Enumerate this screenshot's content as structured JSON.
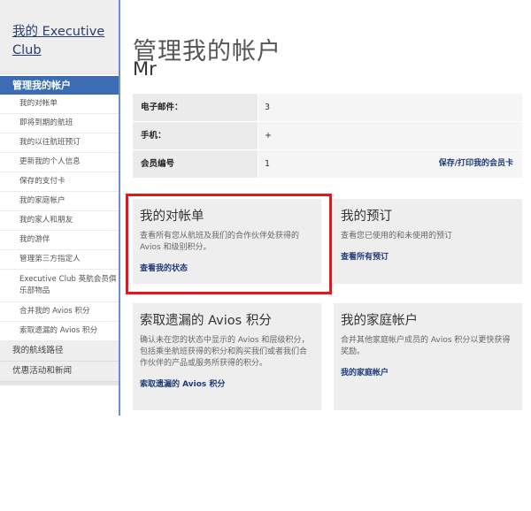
{
  "sidebar": {
    "title": "我的 Executive Club",
    "active": "管理我的帐户",
    "items": [
      "我的对帐单",
      "即将到期的航班",
      "我的以往航班预订",
      "更新我的个人信息",
      "保存的支付卡",
      "我的家庭帐户",
      "我的家人和朋友",
      "我的游伴",
      "管理第三方指定人",
      "Executive Club 英航会员俱乐部物品",
      "合并我的 Avios 积分",
      "索取遗漏的 Avios 积分"
    ],
    "sections": [
      "我的航线路径",
      "优惠活动和新闻"
    ]
  },
  "main": {
    "title": "管理我的帐户",
    "name": "Mr",
    "info": {
      "email_label": "电子邮件：",
      "email_value": "3",
      "mobile_label": "手机：",
      "mobile_value": "+",
      "member_label": "会员编号",
      "member_value": "1",
      "save_print_link": "保存/打印我的会员卡"
    },
    "cards": [
      {
        "title": "我的对帐单",
        "desc": "查看所有您从航班及我们的合作伙伴处获得的 Avios 和级别积分。",
        "link": "查看我的状态"
      },
      {
        "title": "我的预订",
        "desc": "查看您已使用的和未使用的预订",
        "link": "查看所有预订"
      },
      {
        "title": "索取遗漏的 Avios 积分",
        "desc": "确认未在您的状态中显示的 Avios 和层级积分，包括乘坐航班获得的积分和购买我们或者我们合作伙伴的产品或服务所获得的积分。",
        "link": "索取遗漏的 Avios 积分"
      },
      {
        "title": "我的家庭帐户",
        "desc": "合并其他家庭帐户成员的 Avios 积分以更快获得奖励。",
        "link": "我的家庭帐户"
      }
    ]
  }
}
